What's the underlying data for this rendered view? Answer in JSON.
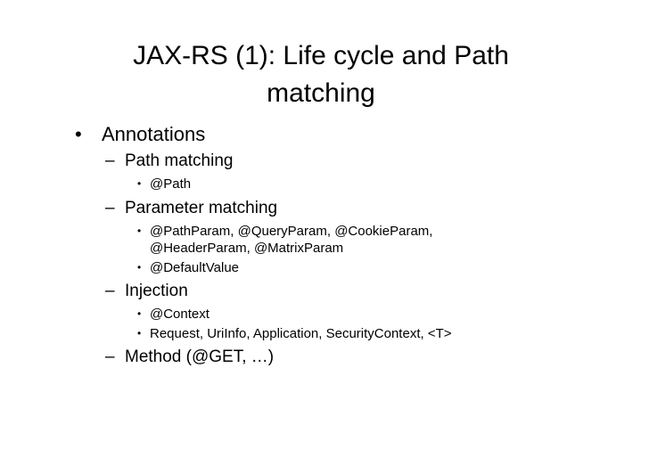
{
  "slide": {
    "title": "JAX-RS (1): Life cycle and Path matching",
    "bullet": "•",
    "dash": "–",
    "items": {
      "annotations": "Annotations",
      "path_matching": "Path matching",
      "path": "@Path",
      "parameter_matching": "Parameter matching",
      "param_annotations": "@PathParam, @QueryParam, @CookieParam, @HeaderParam, @MatrixParam",
      "default_value": "@DefaultValue",
      "injection": "Injection",
      "context": "@Context",
      "injectables": "Request, UriInfo, Application, SecurityContext, <T>",
      "method": "Method (@GET, …)"
    }
  }
}
